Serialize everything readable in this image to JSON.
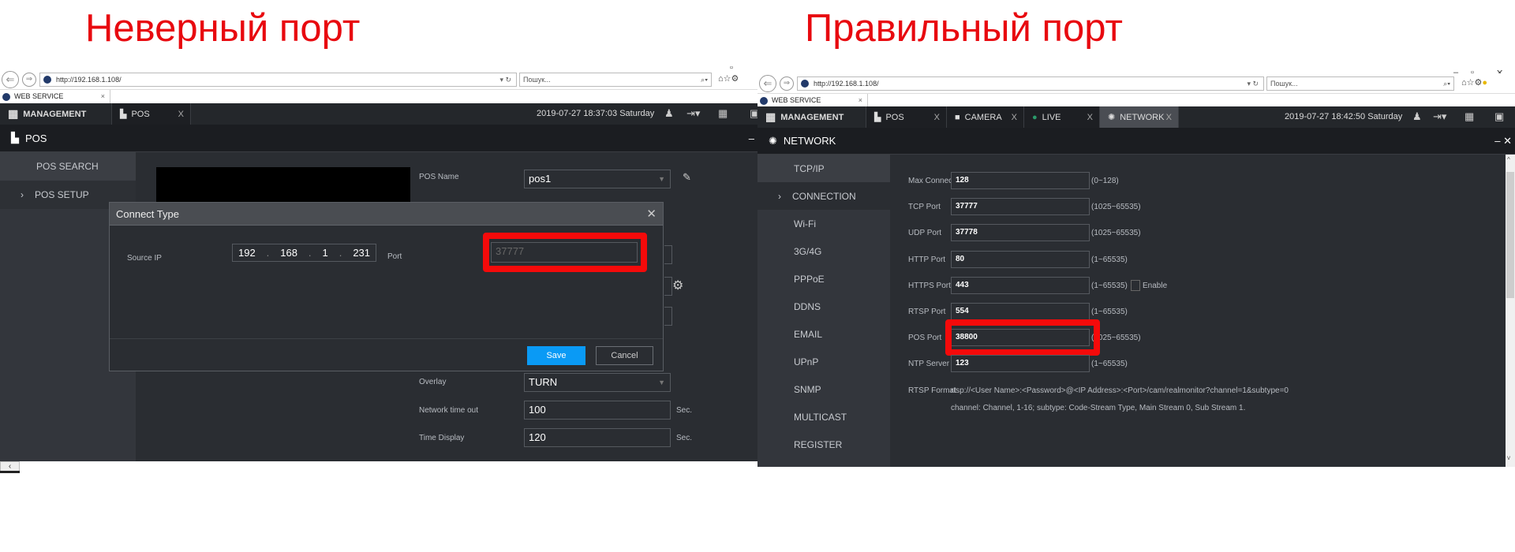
{
  "captions": {
    "wrong": "Неверный порт",
    "right": "Правильный порт"
  },
  "browser": {
    "url": "http://192.168.1.108/",
    "search_placeholder": "Пошук...",
    "tab": "WEB SERVICE"
  },
  "left": {
    "topbar": {
      "management": "MANAGEMENT",
      "tabs": [
        {
          "label": "POS"
        }
      ],
      "datetime": "2019-07-27 18:37:03 Saturday"
    },
    "header": "POS",
    "sidebar": [
      {
        "label": "POS SEARCH"
      },
      {
        "label": "POS SETUP",
        "active": true
      }
    ],
    "form": {
      "pos_name_label": "POS Name",
      "pos_name": "pos1",
      "overlay_label": "Overlay",
      "overlay": "TURN",
      "timeout_label": "Network time out",
      "timeout": "100",
      "time_display_label": "Time Display",
      "time_display": "120",
      "unit": "Sec."
    },
    "dialog": {
      "title": "Connect Type",
      "source_ip_label": "Source IP",
      "ip": [
        "192",
        "168",
        "1",
        "231"
      ],
      "port_label": "Port",
      "port_placeholder": "37777",
      "save": "Save",
      "cancel": "Cancel"
    }
  },
  "right": {
    "topbar": {
      "management": "MANAGEMENT",
      "tabs": [
        {
          "label": "POS"
        },
        {
          "label": "CAMERA"
        },
        {
          "label": "LIVE"
        },
        {
          "label": "NETWORK",
          "active": true
        }
      ],
      "datetime": "2019-07-27 18:42:50 Saturday"
    },
    "header": "NETWORK",
    "sidebar": [
      {
        "label": "TCP/IP"
      },
      {
        "label": "CONNECTION",
        "active": true
      },
      {
        "label": "Wi-Fi"
      },
      {
        "label": "3G/4G"
      },
      {
        "label": "PPPoE"
      },
      {
        "label": "DDNS"
      },
      {
        "label": "EMAIL"
      },
      {
        "label": "UPnP"
      },
      {
        "label": "SNMP"
      },
      {
        "label": "MULTICAST"
      },
      {
        "label": "REGISTER"
      }
    ],
    "form": [
      {
        "label": "Max Connection",
        "value": "128",
        "range": "(0~128)"
      },
      {
        "label": "TCP Port",
        "value": "37777",
        "range": "(1025~65535)"
      },
      {
        "label": "UDP Port",
        "value": "37778",
        "range": "(1025~65535)"
      },
      {
        "label": "HTTP Port",
        "value": "80",
        "range": "(1~65535)"
      },
      {
        "label": "HTTPS Port",
        "value": "443",
        "range": "(1~65535)"
      },
      {
        "label": "RTSP Port",
        "value": "554",
        "range": "(1~65535)"
      },
      {
        "label": "POS Port",
        "value": "38800",
        "range": "(1025~65535)"
      },
      {
        "label": "NTP Server Port",
        "value": "123",
        "range": "(1~65535)"
      }
    ],
    "https_enable": "Enable",
    "rtsp_format_label": "RTSP Format",
    "rtsp_format": "rtsp://<User Name>:<Password>@<IP Address>:<Port>/cam/realmonitor?channel=1&subtype=0",
    "rtsp_note": "channel: Channel, 1-16; subtype: Code-Stream Type, Main Stream 0, Sub Stream 1."
  },
  "highlight_color": "#f50a0a"
}
